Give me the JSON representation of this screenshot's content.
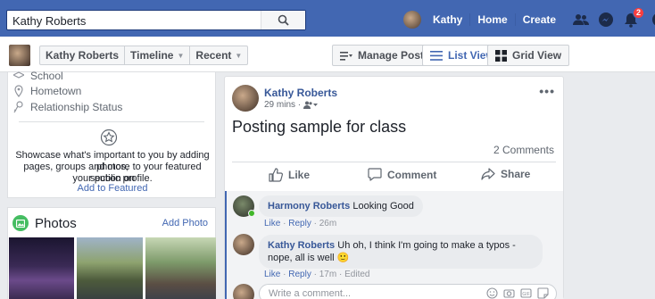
{
  "topbar": {
    "search_value": "Kathy Roberts",
    "user_name": "Kathy",
    "home_label": "Home",
    "create_label": "Create",
    "notification_count": "2"
  },
  "profile_bar": {
    "name": "Kathy Roberts",
    "timeline_label": "Timeline",
    "recent_label": "Recent",
    "manage_posts_label": "Manage Posts",
    "list_view_label": "List View",
    "grid_view_label": "Grid View"
  },
  "intro": {
    "school_label": "School",
    "hometown_label": "Hometown",
    "relationship_label": "Relationship Status",
    "featured_line1": "Showcase what's important to you by adding photos,",
    "featured_line2": "pages, groups and more to your featured section on",
    "featured_line3": "your public profile.",
    "add_featured_label": "Add to Featured"
  },
  "photos": {
    "title": "Photos",
    "add_label": "Add Photo"
  },
  "post": {
    "author": "Kathy Roberts",
    "time": "29 mins ·",
    "text": "Posting sample for class",
    "comment_count": "2 Comments",
    "like_label": "Like",
    "comment_label": "Comment",
    "share_label": "Share"
  },
  "comments": [
    {
      "author": "Harmony Roberts",
      "text": "Looking Good",
      "like": "Like",
      "reply": "Reply",
      "time": "26m"
    },
    {
      "author": "Kathy Roberts",
      "text_line1": "Uh oh, I think I'm going to make a typos - nope, all is",
      "text_line2": "well",
      "emoji": "🙂",
      "like": "Like",
      "reply": "Reply",
      "time": "17m",
      "edited": "Edited"
    }
  ],
  "write_comment_placeholder": "Write a comment...",
  "colors": {
    "brand": "#4267b2",
    "link": "#385898",
    "page_bg": "#e9ebee"
  }
}
